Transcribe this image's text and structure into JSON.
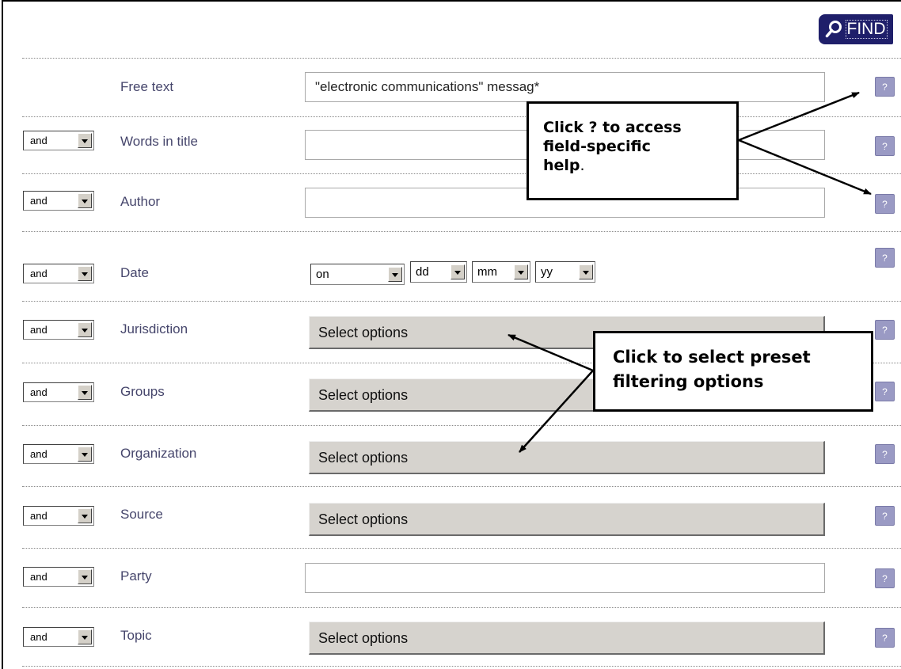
{
  "toolbar": {
    "find_label": "FIND",
    "find_icon": "search-icon"
  },
  "operator_value": "and",
  "help_label": "?",
  "fields": {
    "free_text": {
      "label": "Free text",
      "value": "\"electronic communications\" messag*"
    },
    "title": {
      "label": "Words in title",
      "value": ""
    },
    "author": {
      "label": "Author",
      "value": ""
    },
    "date": {
      "label": "Date",
      "mode": "on",
      "day": "dd",
      "month": "mm",
      "year": "yy"
    },
    "jurisdiction": {
      "label": "Jurisdiction",
      "button": "Select options"
    },
    "groups": {
      "label": "Groups",
      "button": "Select options"
    },
    "organization": {
      "label": "Organization",
      "button": "Select options"
    },
    "source": {
      "label": "Source",
      "button": "Select options"
    },
    "party": {
      "label": "Party",
      "value": ""
    },
    "topic": {
      "label": "Topic",
      "button": "Select options"
    }
  },
  "callouts": {
    "help": {
      "line1": "Click ? to access",
      "line2": "field-specific",
      "line3": "help",
      "line3_suffix": "."
    },
    "options": {
      "line1": "Click to select preset",
      "line2": "filtering options"
    }
  },
  "colors": {
    "find_bg": "#1f1f6a",
    "label": "#46466c",
    "help_button": "#9a9ac4",
    "options_button": "#d6d3ce"
  }
}
